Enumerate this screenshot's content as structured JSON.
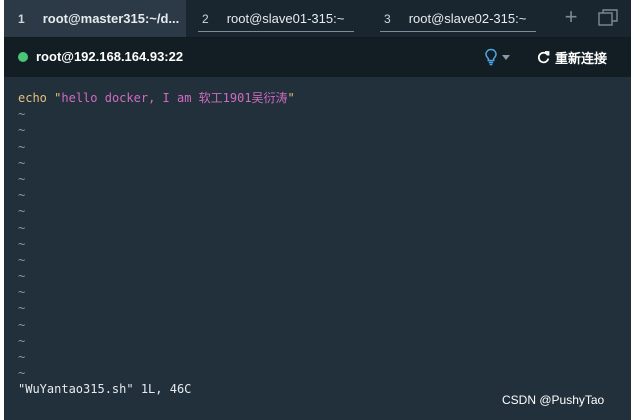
{
  "tabs": [
    {
      "num": "1",
      "label": "root@master315:~/d..."
    },
    {
      "num": "2",
      "label": "root@slave01-315:~"
    },
    {
      "num": "3",
      "label": "root@slave02-315:~"
    }
  ],
  "session": {
    "host": "root@192.168.164.93:22",
    "reconnect_label": "重新连接",
    "status_color": "#48c774"
  },
  "editor": {
    "command": "echo",
    "string_quote_open": "\"",
    "string_content": "hello docker, I am 软工1901吴衍涛",
    "string_quote_close": "\"",
    "tilde": "~",
    "status_line": "\"WuYantao315.sh\" 1L, 46C"
  },
  "watermark": "CSDN @PushyTao",
  "icons": {
    "add_tab": "plus-icon",
    "window": "window-icon",
    "bulb": "lightbulb-icon",
    "reconnect": "refresh-icon"
  }
}
